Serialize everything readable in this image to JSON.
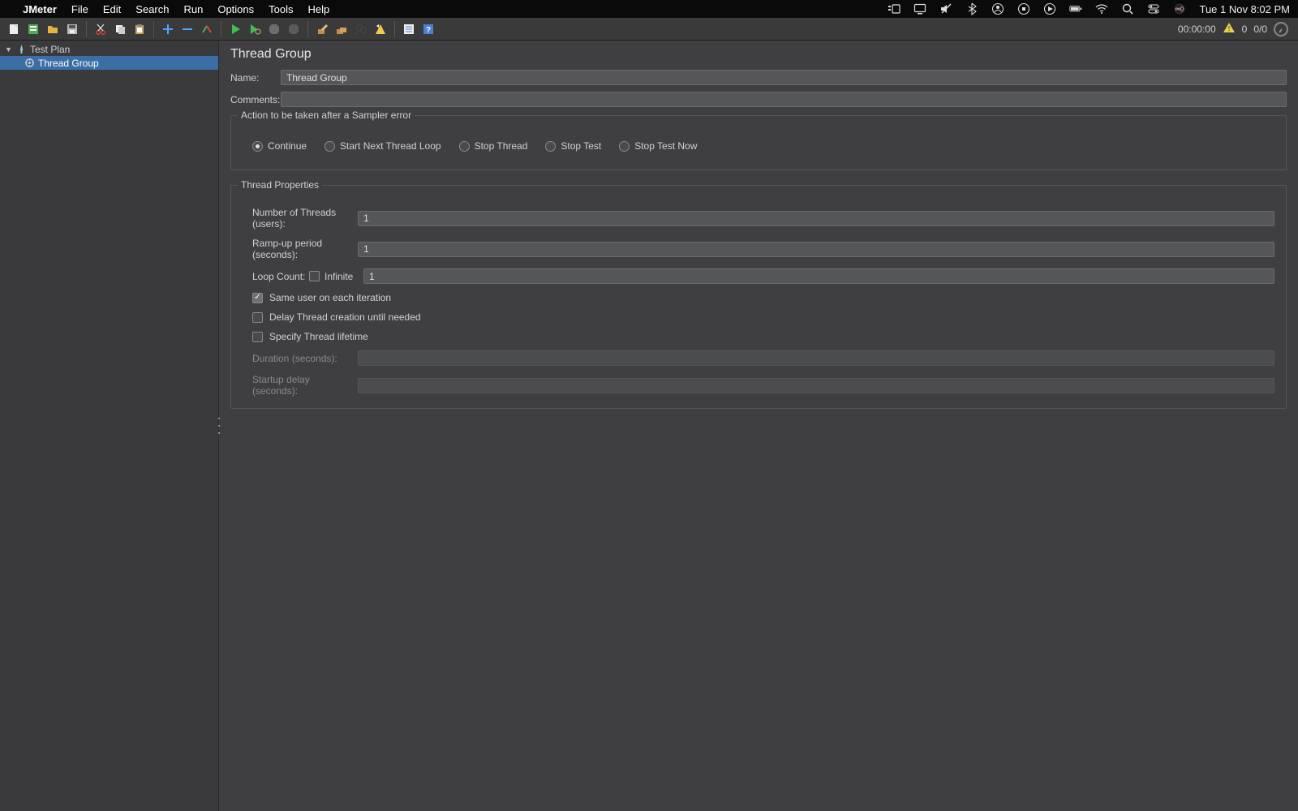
{
  "menubar": {
    "app_name": "JMeter",
    "items": [
      "File",
      "Edit",
      "Search",
      "Run",
      "Options",
      "Tools",
      "Help"
    ],
    "clock": "Tue 1 Nov  8:02 PM"
  },
  "toolbar_status": {
    "elapsed": "00:00:00",
    "active_warn_count": "0",
    "active_thread_ratio": "0/0"
  },
  "tree": {
    "root": {
      "label": "Test Plan"
    },
    "child": {
      "label": "Thread Group"
    }
  },
  "panel": {
    "title": "Thread Group",
    "labels": {
      "name": "Name:",
      "comments": "Comments:"
    },
    "fields": {
      "name": "Thread Group",
      "comments": ""
    },
    "sampler_error": {
      "legend": "Action to be taken after a Sampler error",
      "options": {
        "continue": "Continue",
        "start_next_loop": "Start Next Thread Loop",
        "stop_thread": "Stop Thread",
        "stop_test": "Stop Test",
        "stop_test_now": "Stop Test Now"
      },
      "selected": "continue"
    },
    "thread_props": {
      "legend": "Thread Properties",
      "labels": {
        "num_threads": "Number of Threads (users):",
        "ramp_up": "Ramp-up period (seconds):",
        "loop_count": "Loop Count:",
        "infinite": "Infinite",
        "same_user": "Same user on each iteration",
        "delay_create": "Delay Thread creation until needed",
        "specify_life": "Specify Thread lifetime",
        "duration": "Duration (seconds):",
        "startup_delay": "Startup delay (seconds):"
      },
      "values": {
        "num_threads": "1",
        "ramp_up": "1",
        "loop_count": "1",
        "duration": "",
        "startup_delay": ""
      },
      "checks": {
        "infinite": false,
        "same_user": true,
        "delay_create": false,
        "specify_life": false
      }
    }
  }
}
